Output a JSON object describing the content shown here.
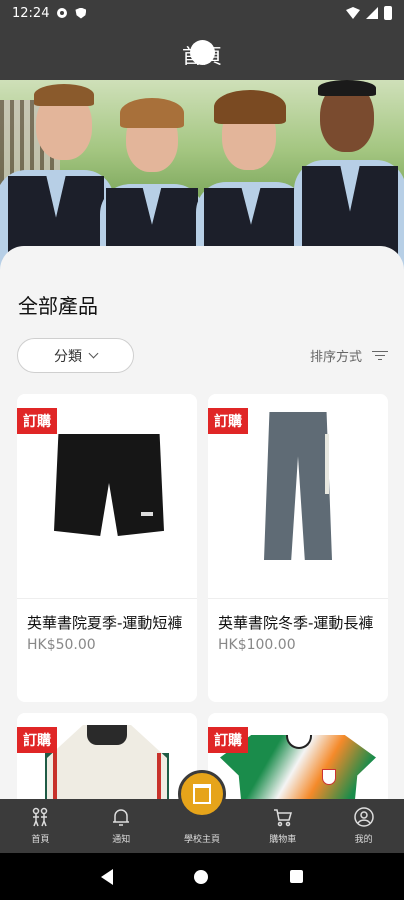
{
  "status_bar": {
    "time": "12:24"
  },
  "header": {
    "title": "首頁"
  },
  "products_section": {
    "title": "全部產品",
    "filter_label": "分類",
    "sort_label": "排序方式"
  },
  "products": [
    {
      "badge": "訂購",
      "name": "英華書院夏季-運動短褲",
      "price": "HK$50.00"
    },
    {
      "badge": "訂購",
      "name": "英華書院冬季-運動長褲",
      "price": "HK$100.00"
    },
    {
      "badge": "訂購",
      "name": "",
      "price": ""
    },
    {
      "badge": "訂購",
      "name": "",
      "price": ""
    }
  ],
  "bottom_nav": {
    "items": [
      {
        "label": "首頁",
        "icon": "kids-icon"
      },
      {
        "label": "通知",
        "icon": "bell-icon"
      },
      {
        "label": "學校主頁",
        "icon": "school-building-icon"
      },
      {
        "label": "購物車",
        "icon": "cart-icon"
      },
      {
        "label": "我的",
        "icon": "user-icon"
      }
    ]
  },
  "colors": {
    "header_bg": "#3d3d3d",
    "badge_red": "#e02626",
    "fab_orange": "#e6a41a"
  }
}
